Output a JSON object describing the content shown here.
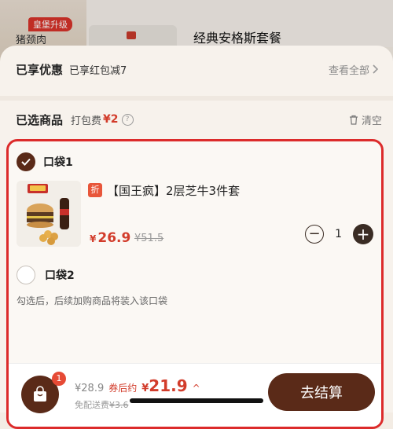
{
  "background": {
    "promo_tag": "皇堡升级",
    "category_label": "猪颈肉",
    "product_title": "经典安格斯套餐"
  },
  "discount": {
    "label": "已享优惠",
    "value": "已享红包减7",
    "link": "查看全部"
  },
  "selected": {
    "label": "已选商品",
    "packaging_fee_label": "打包费",
    "packaging_fee_amount": "¥2",
    "clear_label": "清空"
  },
  "bag1": {
    "label": "口袋1",
    "checked": true,
    "item": {
      "badge": "折",
      "name": "【国王疯】2层芝牛3件套",
      "price_symbol": "¥",
      "price": "26.9",
      "original_price": "¥51.5",
      "quantity": "1"
    }
  },
  "bag2": {
    "label": "口袋2",
    "checked": false
  },
  "bag_hint": "勾选后，后续加购商品将装入该口袋",
  "footer": {
    "cart_badge": "1",
    "total_before": "¥28.9",
    "after_label": "券后约",
    "after_symbol": "¥",
    "after_amount": "21.9",
    "delivery_label": "免配送费",
    "delivery_original": "¥3.6",
    "checkout_label": "去结算"
  },
  "colors": {
    "accent_price": "#d23c2b",
    "brand_brown": "#5a2a18",
    "highlight_border": "#dc2b2b"
  },
  "icons": [
    "chevron-right-icon",
    "help-icon",
    "trash-icon",
    "check-icon",
    "minus-icon",
    "plus-icon",
    "shopping-bag-icon",
    "chevron-up-icon"
  ]
}
